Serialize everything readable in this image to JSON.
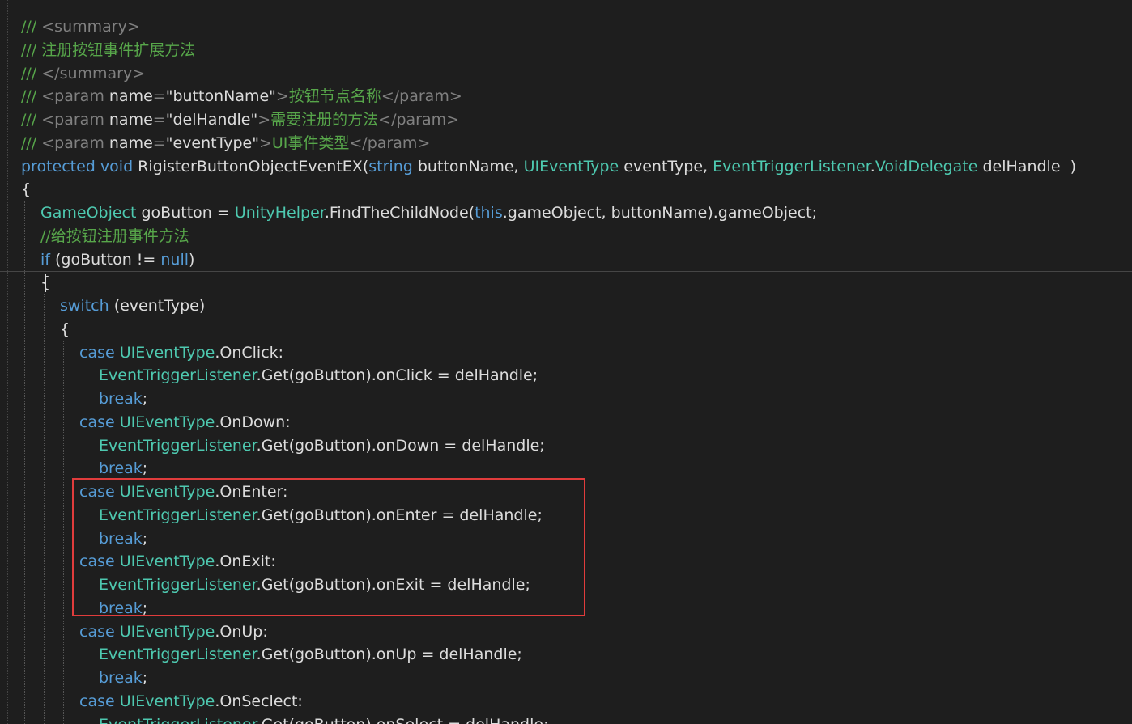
{
  "theme": {
    "background": "#1e1e1e",
    "plain": "#dcdcdc",
    "comment": "#57a64a",
    "doc_tag": "#808080",
    "keyword": "#569cd6",
    "type": "#4ec9b0",
    "string": "#d69d85",
    "highlight_border": "#e03c3c"
  },
  "editor": {
    "lines": [
      {
        "indent": 0,
        "tokens": [
          [
            "/// ",
            "comment"
          ],
          [
            "<summary>",
            "doc_tag"
          ]
        ]
      },
      {
        "indent": 0,
        "tokens": [
          [
            "/// 注册按钮事件扩展方法",
            "comment"
          ]
        ]
      },
      {
        "indent": 0,
        "tokens": [
          [
            "/// ",
            "comment"
          ],
          [
            "</summary>",
            "doc_tag"
          ]
        ]
      },
      {
        "indent": 0,
        "tokens": [
          [
            "/// ",
            "comment"
          ],
          [
            "<param ",
            "doc_tag"
          ],
          [
            "name",
            "plain"
          ],
          [
            "=",
            "doc_tag"
          ],
          [
            "\"buttonName\"",
            "plain"
          ],
          [
            ">",
            "doc_tag"
          ],
          [
            "按钮节点名称",
            "comment"
          ],
          [
            "</param>",
            "doc_tag"
          ]
        ]
      },
      {
        "indent": 0,
        "tokens": [
          [
            "/// ",
            "comment"
          ],
          [
            "<param ",
            "doc_tag"
          ],
          [
            "name",
            "plain"
          ],
          [
            "=",
            "doc_tag"
          ],
          [
            "\"delHandle\"",
            "plain"
          ],
          [
            ">",
            "doc_tag"
          ],
          [
            "需要注册的方法",
            "comment"
          ],
          [
            "</param>",
            "doc_tag"
          ]
        ]
      },
      {
        "indent": 0,
        "tokens": [
          [
            "/// ",
            "comment"
          ],
          [
            "<param ",
            "doc_tag"
          ],
          [
            "name",
            "plain"
          ],
          [
            "=",
            "doc_tag"
          ],
          [
            "\"eventType\"",
            "plain"
          ],
          [
            ">",
            "doc_tag"
          ],
          [
            "UI事件类型",
            "comment"
          ],
          [
            "</param>",
            "doc_tag"
          ]
        ]
      },
      {
        "indent": 0,
        "tokens": [
          [
            "protected",
            "keyword"
          ],
          [
            " ",
            "plain"
          ],
          [
            "void",
            "keyword"
          ],
          [
            " RigisterButtonObjectEventEX(",
            "plain"
          ],
          [
            "string",
            "keyword"
          ],
          [
            " buttonName, ",
            "plain"
          ],
          [
            "UIEventType",
            "type"
          ],
          [
            " eventType, ",
            "plain"
          ],
          [
            "EventTriggerListener",
            "type"
          ],
          [
            ".",
            "plain"
          ],
          [
            "VoidDelegate",
            "type"
          ],
          [
            " delHandle  )",
            "plain"
          ]
        ]
      },
      {
        "indent": 0,
        "tokens": [
          [
            "{",
            "plain"
          ]
        ]
      },
      {
        "indent": 1,
        "tokens": [
          [
            "GameObject",
            "type"
          ],
          [
            " goButton = ",
            "plain"
          ],
          [
            "UnityHelper",
            "type"
          ],
          [
            ".FindTheChildNode(",
            "plain"
          ],
          [
            "this",
            "keyword"
          ],
          [
            ".gameObject, buttonName).gameObject;",
            "plain"
          ]
        ]
      },
      {
        "indent": 1,
        "tokens": [
          [
            "//给按钮注册事件方法",
            "comment"
          ]
        ]
      },
      {
        "indent": 1,
        "tokens": [
          [
            "if",
            "keyword"
          ],
          [
            " (goButton != ",
            "plain"
          ],
          [
            "null",
            "keyword"
          ],
          [
            ")",
            "plain"
          ]
        ]
      },
      {
        "indent": 1,
        "tokens": [
          [
            "{",
            "plain"
          ]
        ]
      },
      {
        "indent": 2,
        "tokens": [
          [
            "switch",
            "keyword"
          ],
          [
            " (eventType)",
            "plain"
          ]
        ]
      },
      {
        "indent": 2,
        "tokens": [
          [
            "{",
            "plain"
          ]
        ]
      },
      {
        "indent": 3,
        "tokens": [
          [
            "case",
            "keyword"
          ],
          [
            " ",
            "plain"
          ],
          [
            "UIEventType",
            "type"
          ],
          [
            ".OnClick:",
            "plain"
          ]
        ]
      },
      {
        "indent": 4,
        "tokens": [
          [
            "EventTriggerListener",
            "type"
          ],
          [
            ".Get(goButton).onClick = delHandle;",
            "plain"
          ]
        ]
      },
      {
        "indent": 4,
        "tokens": [
          [
            "break",
            "keyword"
          ],
          [
            ";",
            "plain"
          ]
        ]
      },
      {
        "indent": 3,
        "tokens": [
          [
            "case",
            "keyword"
          ],
          [
            " ",
            "plain"
          ],
          [
            "UIEventType",
            "type"
          ],
          [
            ".OnDown:",
            "plain"
          ]
        ]
      },
      {
        "indent": 4,
        "tokens": [
          [
            "EventTriggerListener",
            "type"
          ],
          [
            ".Get(goButton).onDown = delHandle;",
            "plain"
          ]
        ]
      },
      {
        "indent": 4,
        "tokens": [
          [
            "break",
            "keyword"
          ],
          [
            ";",
            "plain"
          ]
        ]
      },
      {
        "indent": 3,
        "tokens": [
          [
            "case",
            "keyword"
          ],
          [
            " ",
            "plain"
          ],
          [
            "UIEventType",
            "type"
          ],
          [
            ".OnEnter:",
            "plain"
          ]
        ]
      },
      {
        "indent": 4,
        "tokens": [
          [
            "EventTriggerListener",
            "type"
          ],
          [
            ".Get(goButton).onEnter = delHandle;",
            "plain"
          ]
        ]
      },
      {
        "indent": 4,
        "tokens": [
          [
            "break",
            "keyword"
          ],
          [
            ";",
            "plain"
          ]
        ]
      },
      {
        "indent": 3,
        "tokens": [
          [
            "case",
            "keyword"
          ],
          [
            " ",
            "plain"
          ],
          [
            "UIEventType",
            "type"
          ],
          [
            ".OnExit:",
            "plain"
          ]
        ]
      },
      {
        "indent": 4,
        "tokens": [
          [
            "EventTriggerListener",
            "type"
          ],
          [
            ".Get(goButton).onExit = delHandle;",
            "plain"
          ]
        ]
      },
      {
        "indent": 4,
        "tokens": [
          [
            "break",
            "keyword"
          ],
          [
            ";",
            "plain"
          ]
        ]
      },
      {
        "indent": 3,
        "tokens": [
          [
            "case",
            "keyword"
          ],
          [
            " ",
            "plain"
          ],
          [
            "UIEventType",
            "type"
          ],
          [
            ".OnUp:",
            "plain"
          ]
        ]
      },
      {
        "indent": 4,
        "tokens": [
          [
            "EventTriggerListener",
            "type"
          ],
          [
            ".Get(goButton).onUp = delHandle;",
            "plain"
          ]
        ]
      },
      {
        "indent": 4,
        "tokens": [
          [
            "break",
            "keyword"
          ],
          [
            ";",
            "plain"
          ]
        ]
      },
      {
        "indent": 3,
        "tokens": [
          [
            "case",
            "keyword"
          ],
          [
            " ",
            "plain"
          ],
          [
            "UIEventType",
            "type"
          ],
          [
            ".OnSeclect:",
            "plain"
          ]
        ]
      },
      {
        "indent": 4,
        "tokens": [
          [
            "EventTriggerListener",
            "type"
          ],
          [
            ".Get(goButton).onSelect = delHandle;",
            "plain"
          ]
        ]
      }
    ]
  }
}
